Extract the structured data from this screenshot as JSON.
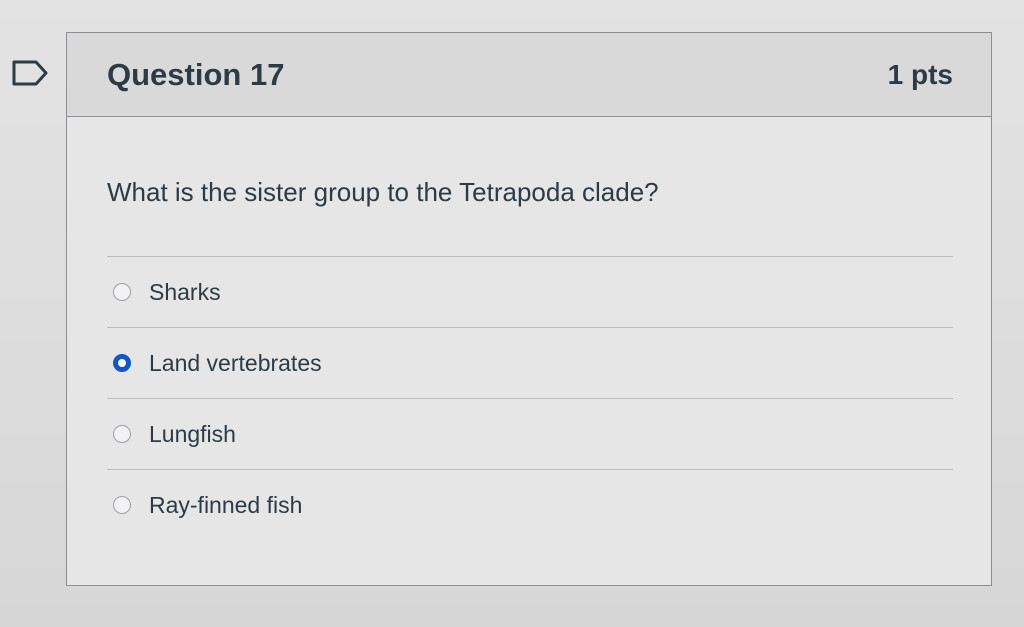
{
  "question": {
    "title": "Question 17",
    "points": "1 pts",
    "text": "What is the sister group to the Tetrapoda clade?",
    "flag_icon": "flag-outline-icon",
    "answers": [
      {
        "label": "Sharks",
        "selected": false
      },
      {
        "label": "Land vertebrates",
        "selected": true
      },
      {
        "label": "Lungfish",
        "selected": false
      },
      {
        "label": "Ray-finned fish",
        "selected": false
      }
    ]
  },
  "colors": {
    "text": "#2d3b45",
    "selected_radio": "#1157c9",
    "border": "#8b8f94"
  }
}
